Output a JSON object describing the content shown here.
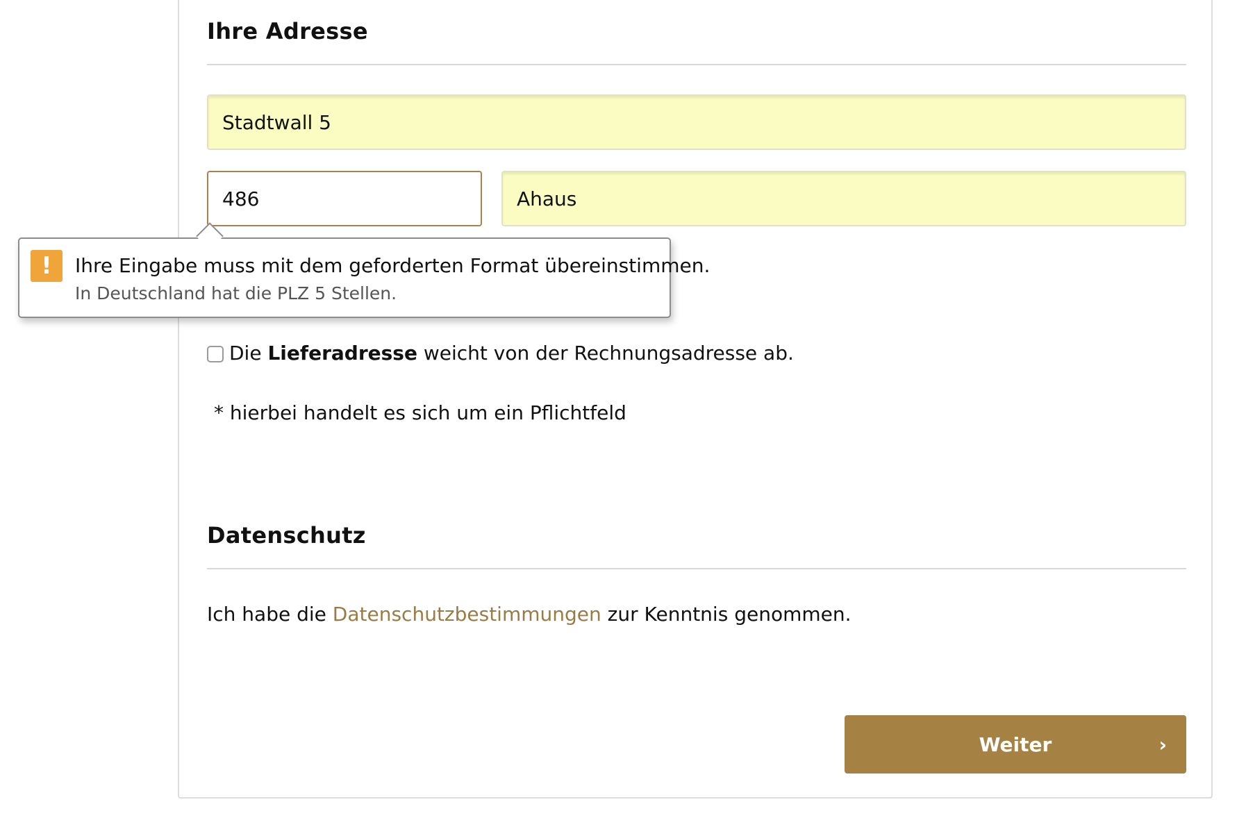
{
  "address_section": {
    "title": "Ihre Adresse",
    "street_value": "Stadtwall 5",
    "zip_value": "486",
    "city_value": "Ahaus"
  },
  "validation_tooltip": {
    "icon": "warning-exclamation-icon",
    "icon_glyph": "!",
    "message": "Ihre Eingabe muss mit dem geforderten Format übereinstimmen.",
    "hint": "In Deutschland hat die PLZ 5 Stellen."
  },
  "delivery_checkbox": {
    "checked": false,
    "label_prefix": "Die ",
    "label_bold": "Lieferadresse",
    "label_suffix": " weicht von der Rechnungsadresse ab."
  },
  "required_note": "* hierbei handelt es sich um ein Pflichtfeld",
  "privacy_section": {
    "title": "Datenschutz",
    "text_prefix": "Ich habe die ",
    "link_text": "Datenschutzbestimmungen",
    "text_suffix": " zur Kenntnis genommen."
  },
  "next_button": {
    "label": "Weiter",
    "chevron": "›"
  },
  "colors": {
    "autofill_background": "#fafcc2",
    "accent_brown": "#a58143",
    "link_color": "#9b7b45",
    "warning_orange": "#f0a53a"
  }
}
